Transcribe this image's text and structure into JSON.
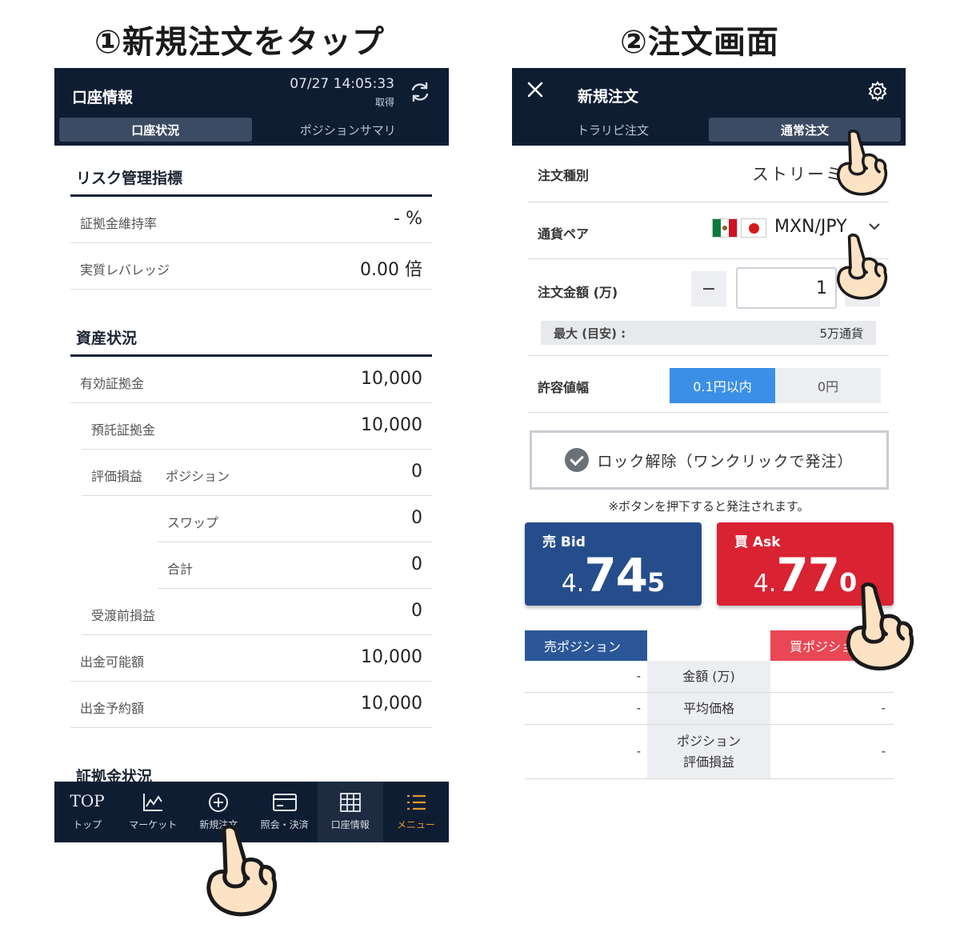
{
  "captions": {
    "step1": "①新規注文をタップ",
    "step2": "②注文画面"
  },
  "left": {
    "header": {
      "title": "口座情報",
      "datetime": "07/27 14:05:33",
      "datetime_sub": "取得",
      "refresh_icon": "refresh-icon"
    },
    "segments": [
      {
        "label": "口座状況",
        "active": true
      },
      {
        "label": "ポジションサマリ",
        "active": false
      }
    ],
    "risk": {
      "title": "リスク管理指標",
      "rows": [
        {
          "label": "証拠金維持率",
          "value": "- %"
        },
        {
          "label": "実質レバレッジ",
          "value": "0.00 倍"
        }
      ]
    },
    "assets": {
      "title": "資産状況",
      "effective_margin": {
        "label": "有効証拠金",
        "value": "10,000"
      },
      "deposit_margin": {
        "label": "預託証拠金",
        "value": "10,000"
      },
      "valuation": {
        "label": "評価損益",
        "position_label": "ポジション",
        "position_value": "0",
        "swap_label": "スワップ",
        "swap_value": "0",
        "total_label": "合計",
        "total_value": "0"
      },
      "pre_delivery": {
        "label": "受渡前損益",
        "value": "0"
      },
      "withdrawable": {
        "label": "出金可能額",
        "value": "10,000"
      },
      "withdraw_reserved": {
        "label": "出金予約額",
        "value": "10,000"
      }
    },
    "margin_status_title": "証拠金状況",
    "tabbar": [
      {
        "icon_text": "TOP",
        "label": "トップ"
      },
      {
        "icon": "chart-icon",
        "label": "マーケット"
      },
      {
        "icon": "plus-circle-icon",
        "label": "新規注文"
      },
      {
        "icon": "card-icon",
        "label": "照会・決済"
      },
      {
        "icon": "grid-icon",
        "label": "口座情報",
        "active": true
      },
      {
        "icon": "menu-icon",
        "label": "メニュー"
      }
    ]
  },
  "right": {
    "header": {
      "title": "新規注文",
      "close_icon": "close-icon",
      "settings_icon": "gear-icon"
    },
    "segments": [
      {
        "label": "トラリピ注文",
        "active": false
      },
      {
        "label": "通常注文",
        "active": true
      }
    ],
    "order_type": {
      "label": "注文種別",
      "value": "ストリーミング"
    },
    "currency_pair": {
      "label": "通貨ペア",
      "value": "MXN/JPY"
    },
    "amount": {
      "label": "注文金額 (万)",
      "minus": "−",
      "value": "1"
    },
    "max": {
      "label": "最大 (目安) :",
      "value": "5万通貨"
    },
    "tolerance": {
      "label": "許容値幅",
      "options": [
        "0.1円以内",
        "0円"
      ],
      "selected": "0.1円以内"
    },
    "lock": {
      "label": "ロック解除（ワンクリックで発注）"
    },
    "note": "※ボタンを押下すると発注されます。",
    "bid": {
      "label": "売 Bid",
      "p1": "4.",
      "p2": "74",
      "p3": "5"
    },
    "ask": {
      "label": "買 Ask",
      "p1": "4.",
      "p2": "77",
      "p3": "0"
    },
    "positions": {
      "sell_header": "売ポジション",
      "buy_header": "買ポジション",
      "rows": [
        {
          "label": "金額 (万)",
          "sell": "-",
          "buy": ""
        },
        {
          "label": "平均価格",
          "sell": "-",
          "buy": "-"
        },
        {
          "label_line1": "ポジション",
          "label_line2": "評価損益",
          "sell": "-",
          "buy": "-"
        }
      ]
    },
    "colors": {
      "bid": "#254d8c",
      "ask": "#d92232",
      "header": "#0f1d33",
      "toggle_on": "#3c8fe6"
    }
  },
  "pointer_icon": "pointing-hand-icon"
}
